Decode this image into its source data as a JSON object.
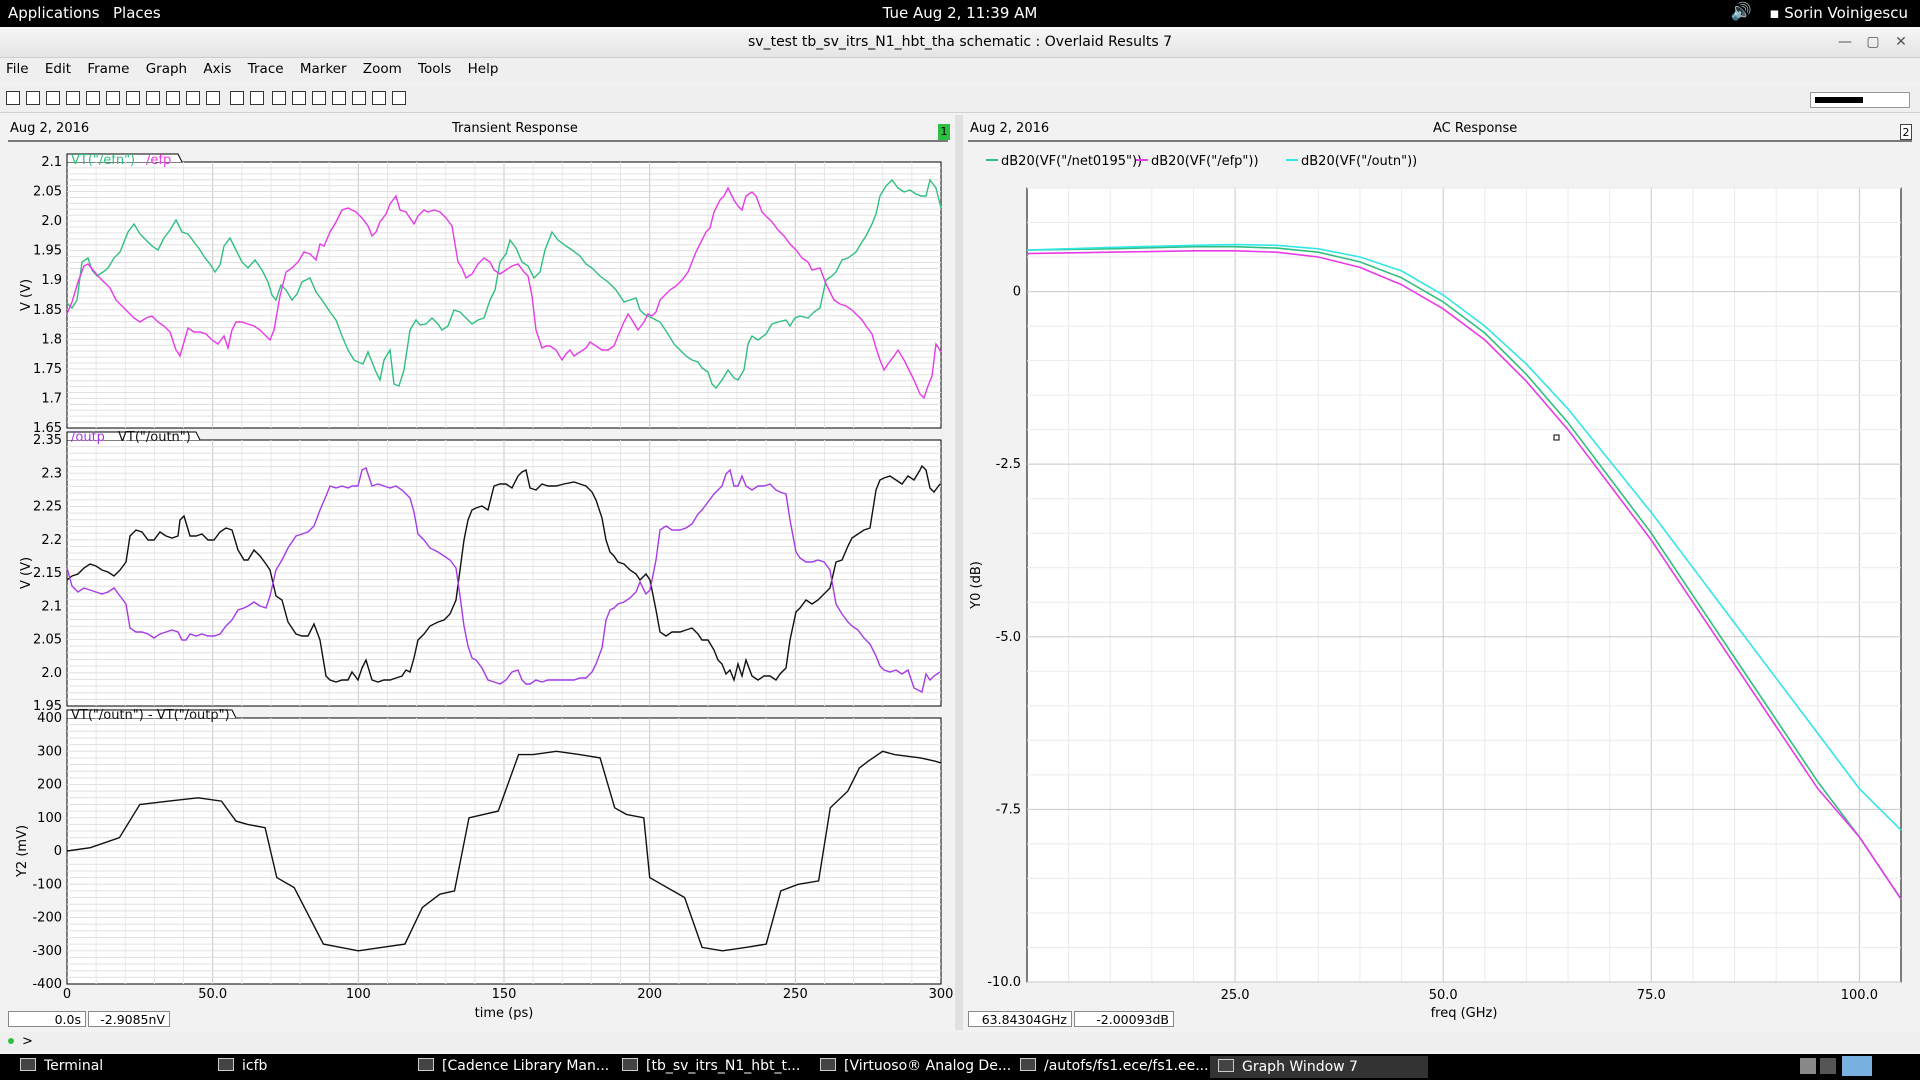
{
  "topbar": {
    "applications": "Applications",
    "places": "Places",
    "clock": "Tue Aug  2, 11:39 AM",
    "user": "Sorin Voinigescu"
  },
  "window": {
    "title": "sv_test tb_sv_itrs_N1_hbt_tha schematic : Overlaid Results 7"
  },
  "menu": [
    "File",
    "Edit",
    "Frame",
    "Graph",
    "Axis",
    "Trace",
    "Marker",
    "Zoom",
    "Tools",
    "Help"
  ],
  "left": {
    "date": "Aug 2, 2016",
    "title": "Transient Response",
    "badge": "1",
    "xlabel": "time (ps)",
    "readout_x": "0.0s",
    "readout_y": "-2.9085nV"
  },
  "right": {
    "date": "Aug 2, 2016",
    "title": "AC Response",
    "badge": "2",
    "xlabel": "freq (GHz)",
    "ylabel": "Y0 (dB)",
    "readout_x": "63.84304GHz",
    "readout_y": "-2.00093dB",
    "legend": [
      "dB20(VF(\"/net0195\"))",
      "dB20(VF(\"/efp\"))",
      "dB20(VF(\"/outn\"))"
    ]
  },
  "colors": {
    "green": "#2fbf7f",
    "magenta": "#e63be6",
    "purple": "#a63be6",
    "cyan": "#33e6e6",
    "black": "#111111"
  },
  "chart_data": [
    {
      "type": "line",
      "title": "",
      "ylabel": "V (V)",
      "xlabel": "",
      "ylim": [
        1.65,
        2.1
      ],
      "yticks": [
        "2.1",
        "2.05",
        "2.0",
        "1.95",
        "1.9",
        "1.85",
        "1.8",
        "1.75",
        "1.7",
        "1.65"
      ],
      "legend": [
        "VT(\"/efn\")",
        "/efp"
      ],
      "series": [
        {
          "name": "VT(\"/efn\")",
          "color": "green",
          "x": [
            0,
            300
          ],
          "y": [
            1.85,
            1.85
          ]
        },
        {
          "name": "/efp",
          "color": "magenta",
          "x": [
            0,
            300
          ],
          "y": [
            1.9,
            1.9
          ]
        }
      ]
    },
    {
      "type": "line",
      "title": "",
      "ylabel": "V (V)",
      "xlabel": "",
      "ylim": [
        1.95,
        2.35
      ],
      "yticks": [
        "2.35",
        "2.3",
        "2.25",
        "2.2",
        "2.15",
        "2.1",
        "2.05",
        "2.0",
        "1.95"
      ],
      "legend": [
        "/outp",
        "VT(\"/outn\")"
      ],
      "series": [
        {
          "name": "/outp",
          "color": "purple",
          "x": [
            0,
            300
          ],
          "y": [
            2.12,
            2.12
          ]
        },
        {
          "name": "VT(\"/outn\")",
          "color": "black",
          "x": [
            0,
            300
          ],
          "y": [
            2.15,
            2.15
          ]
        }
      ]
    },
    {
      "type": "line",
      "title": "",
      "ylabel": "Y2 (mV)",
      "xlabel": "time (ps)",
      "ylim": [
        -400,
        400
      ],
      "xlim": [
        0,
        300
      ],
      "yticks": [
        "400",
        "300",
        "200",
        "100",
        "0",
        "-100",
        "-200",
        "-300",
        "-400"
      ],
      "xticks": [
        "0",
        "50.0",
        "100",
        "150",
        "200",
        "250",
        "300"
      ],
      "legend": [
        "VT(\"/outn\") - VT(\"/outp\")"
      ],
      "series": [
        {
          "name": "VT(\"/outn\") - VT(\"/outp\")",
          "color": "black",
          "x": [
            0,
            8,
            18,
            25,
            35,
            45,
            53,
            58,
            62,
            68,
            72,
            78,
            88,
            94,
            100,
            108,
            116,
            122,
            128,
            133,
            138,
            148,
            155,
            160,
            168,
            176,
            183,
            188,
            192,
            198,
            200,
            208,
            212,
            218,
            225,
            233,
            240,
            245,
            251,
            258,
            262,
            268,
            272,
            275,
            280,
            284,
            293,
            298,
            300
          ],
          "y": [
            0,
            10,
            40,
            140,
            150,
            160,
            150,
            90,
            80,
            70,
            -80,
            -110,
            -280,
            -290,
            -300,
            -290,
            -280,
            -170,
            -130,
            -120,
            100,
            120,
            290,
            290,
            300,
            290,
            280,
            130,
            110,
            100,
            -80,
            -120,
            -140,
            -290,
            -300,
            -290,
            -280,
            -120,
            -100,
            -90,
            130,
            180,
            250,
            270,
            300,
            290,
            280,
            270,
            265
          ]
        }
      ]
    },
    {
      "type": "line",
      "title": "",
      "xlabel": "freq (GHz)",
      "ylabel": "Y0 (dB)",
      "xlim": [
        0,
        105
      ],
      "ylim": [
        -10,
        1.5
      ],
      "xticks": [
        "25.0",
        "50.0",
        "75.0",
        "100.0"
      ],
      "yticks": [
        "0",
        "-2.5",
        "-5.0",
        "-7.5",
        "-10.0"
      ],
      "series": [
        {
          "name": "dB20(VF(\"/net0195\"))",
          "color": "green",
          "x": [
            0,
            10,
            20,
            25,
            30,
            35,
            40,
            45,
            50,
            55,
            60,
            65,
            70,
            75,
            80,
            85,
            90,
            95,
            100,
            105
          ],
          "y": [
            0.6,
            0.62,
            0.65,
            0.65,
            0.63,
            0.57,
            0.43,
            0.2,
            -0.15,
            -0.6,
            -1.2,
            -1.9,
            -2.7,
            -3.5,
            -4.4,
            -5.3,
            -6.2,
            -7.1,
            -7.9,
            -8.8
          ]
        },
        {
          "name": "dB20(VF(\"/efp\"))",
          "color": "magenta",
          "x": [
            0,
            10,
            20,
            25,
            30,
            35,
            40,
            45,
            50,
            55,
            60,
            65,
            70,
            75,
            80,
            85,
            90,
            95,
            100,
            105
          ],
          "y": [
            0.55,
            0.57,
            0.59,
            0.59,
            0.57,
            0.5,
            0.35,
            0.1,
            -0.25,
            -0.7,
            -1.3,
            -2.0,
            -2.8,
            -3.6,
            -4.5,
            -5.4,
            -6.3,
            -7.2,
            -7.9,
            -8.8
          ]
        },
        {
          "name": "dB20(VF(\"/outn\"))",
          "color": "cyan",
          "x": [
            0,
            10,
            20,
            25,
            30,
            35,
            40,
            45,
            50,
            55,
            60,
            65,
            70,
            75,
            80,
            85,
            90,
            95,
            100,
            105
          ],
          "y": [
            0.6,
            0.64,
            0.67,
            0.68,
            0.67,
            0.62,
            0.5,
            0.3,
            -0.05,
            -0.5,
            -1.05,
            -1.7,
            -2.45,
            -3.2,
            -4.0,
            -4.8,
            -5.6,
            -6.4,
            -7.2,
            -7.8
          ]
        }
      ]
    }
  ],
  "commandline": ">",
  "taskbar": [
    "Terminal",
    "icfb",
    "[Cadence Library Man...",
    "[tb_sv_itrs_N1_hbt_t...",
    "[Virtuoso® Analog De...",
    "/autofs/fs1.ece/fs1.ee...",
    "Graph Window 7"
  ]
}
